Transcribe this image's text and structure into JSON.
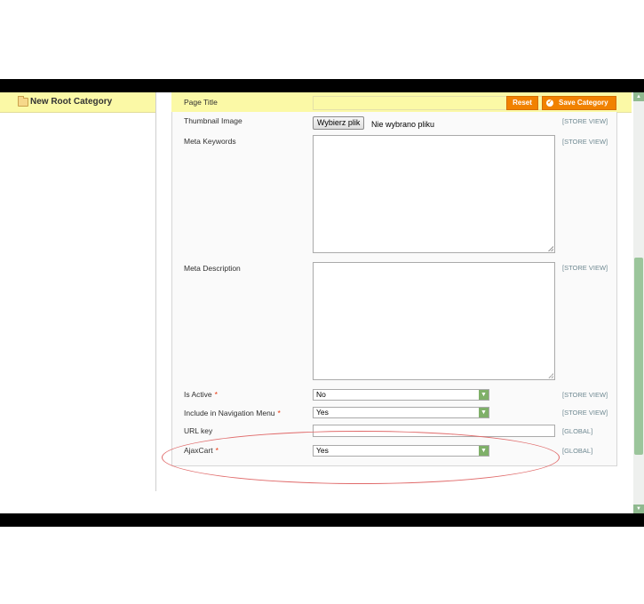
{
  "tree": {
    "root_label": "New Root Category"
  },
  "toolbar": {
    "reset_label": "Reset",
    "save_label": "Save Category"
  },
  "fields": {
    "page_title": {
      "label": "Page Title",
      "value": ""
    },
    "thumbnail_image": {
      "label": "Thumbnail Image",
      "button_label": "Wybierz plik",
      "status": "Nie wybrano pliku",
      "scope": "[STORE VIEW]"
    },
    "meta_keywords": {
      "label": "Meta Keywords",
      "value": "",
      "scope": "[STORE VIEW]"
    },
    "meta_description": {
      "label": "Meta Description",
      "value": "",
      "scope": "[STORE VIEW]"
    },
    "is_active": {
      "label": "Is Active",
      "required": "*",
      "value": "No",
      "scope": "[STORE VIEW]"
    },
    "include_in_nav": {
      "label": "Include in Navigation Menu",
      "required": "*",
      "value": "Yes",
      "scope": "[STORE VIEW]"
    },
    "url_key": {
      "label": "URL key",
      "value": "",
      "scope": "[GLOBAL]"
    },
    "ajaxcart": {
      "label": "AjaxCart",
      "required": "*",
      "value": "Yes",
      "scope": "[GLOBAL]"
    }
  },
  "icons": {
    "folder": "folder-icon",
    "check": "check-circle-icon",
    "dropdown": "chevron-down-icon",
    "resize": "resize-grip-icon"
  },
  "colors": {
    "header_bg": "#fbf9a6",
    "button_bg": "#f18200",
    "scope_text": "#6f8992",
    "required": "#eb340a",
    "highlight": "#e06a6a"
  }
}
